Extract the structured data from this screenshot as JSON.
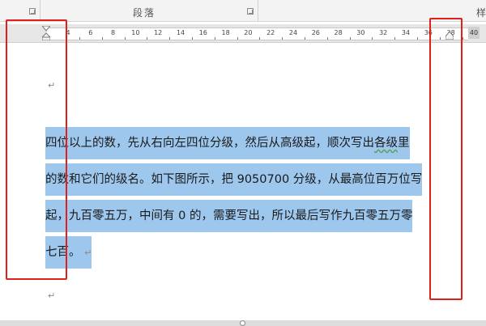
{
  "ribbon": {
    "paragraph_group_label": "段落",
    "right_group_label": "样"
  },
  "ruler": {
    "ticks": [
      "4",
      "6",
      "8",
      "10",
      "12",
      "14",
      "16",
      "18",
      "20",
      "22",
      "24",
      "26",
      "28",
      "30",
      "32",
      "34",
      "36",
      "38"
    ],
    "end_label": "40"
  },
  "document": {
    "lines": [
      "四位以上的数，先从右向左四位分级，然后从高级起，顺次写出各级里",
      "的数和它们的级名。如下图所示，把 9050700 分级，从最高位百万位写",
      "起，九百零五万，中间有 0 的，需要写出，所以最后写作九百零五万零",
      "七百。"
    ],
    "paragraph_mark": "↵",
    "squiggle_word": "各级"
  },
  "colors": {
    "highlight": "#9ec7ee",
    "annotation": "#e0201a"
  }
}
